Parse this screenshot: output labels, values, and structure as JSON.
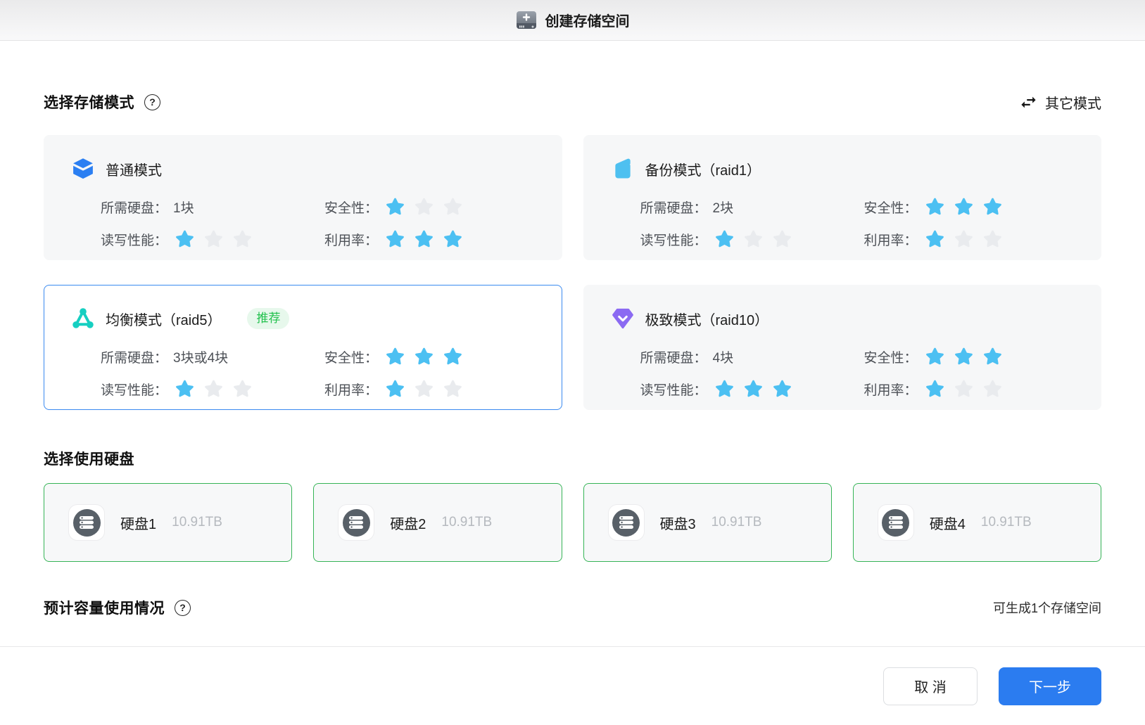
{
  "window": {
    "title": "创建存储空间"
  },
  "icons": {
    "help_glyph": "?"
  },
  "colors": {
    "accent_blue": "#2b7cf0",
    "selected_border": "#3a8af0",
    "star_on": "#4cc0f2",
    "star_off": "#e9ebee",
    "disk_border": "#36b456",
    "badge_green": "#23c14e",
    "badge_bg": "#e7f8ec",
    "cube_blue": "#2b7ff2",
    "copy_blue": "#4ec0f0",
    "network_teal": "#16cfc1",
    "gem_purple": "#8b6af2"
  },
  "modes_section": {
    "title": "选择存储模式",
    "other_modes_label": "其它模式",
    "labels": {
      "disks": "所需硬盘：",
      "security": "安全性：",
      "performance": "读写性能：",
      "utilization": "利用率："
    },
    "items": [
      {
        "title": "普通模式",
        "icon": "cube-icon",
        "disks": "1块",
        "security": 1,
        "performance": 1,
        "utilization": 3,
        "selected": false
      },
      {
        "title": "备份模式（raid1）",
        "icon": "copy-icon",
        "disks": "2块",
        "security": 3,
        "performance": 1,
        "utilization": 1,
        "selected": false
      },
      {
        "title": "均衡模式（raid5）",
        "icon": "network-icon",
        "badge": "推荐",
        "disks": "3块或4块",
        "security": 3,
        "performance": 1,
        "utilization": 1,
        "selected": true
      },
      {
        "title": "极致模式（raid10）",
        "icon": "gem-icon",
        "disks": "4块",
        "security": 3,
        "performance": 3,
        "utilization": 1,
        "selected": false
      }
    ]
  },
  "disks_section": {
    "title": "选择使用硬盘",
    "items": [
      {
        "name": "硬盘1",
        "size": "10.91TB"
      },
      {
        "name": "硬盘2",
        "size": "10.91TB"
      },
      {
        "name": "硬盘3",
        "size": "10.91TB"
      },
      {
        "name": "硬盘4",
        "size": "10.91TB"
      }
    ]
  },
  "capacity_section": {
    "title": "预计容量使用情况",
    "note": "可生成1个存储空间"
  },
  "footer": {
    "cancel_label": "取 消",
    "next_label": "下一步"
  }
}
